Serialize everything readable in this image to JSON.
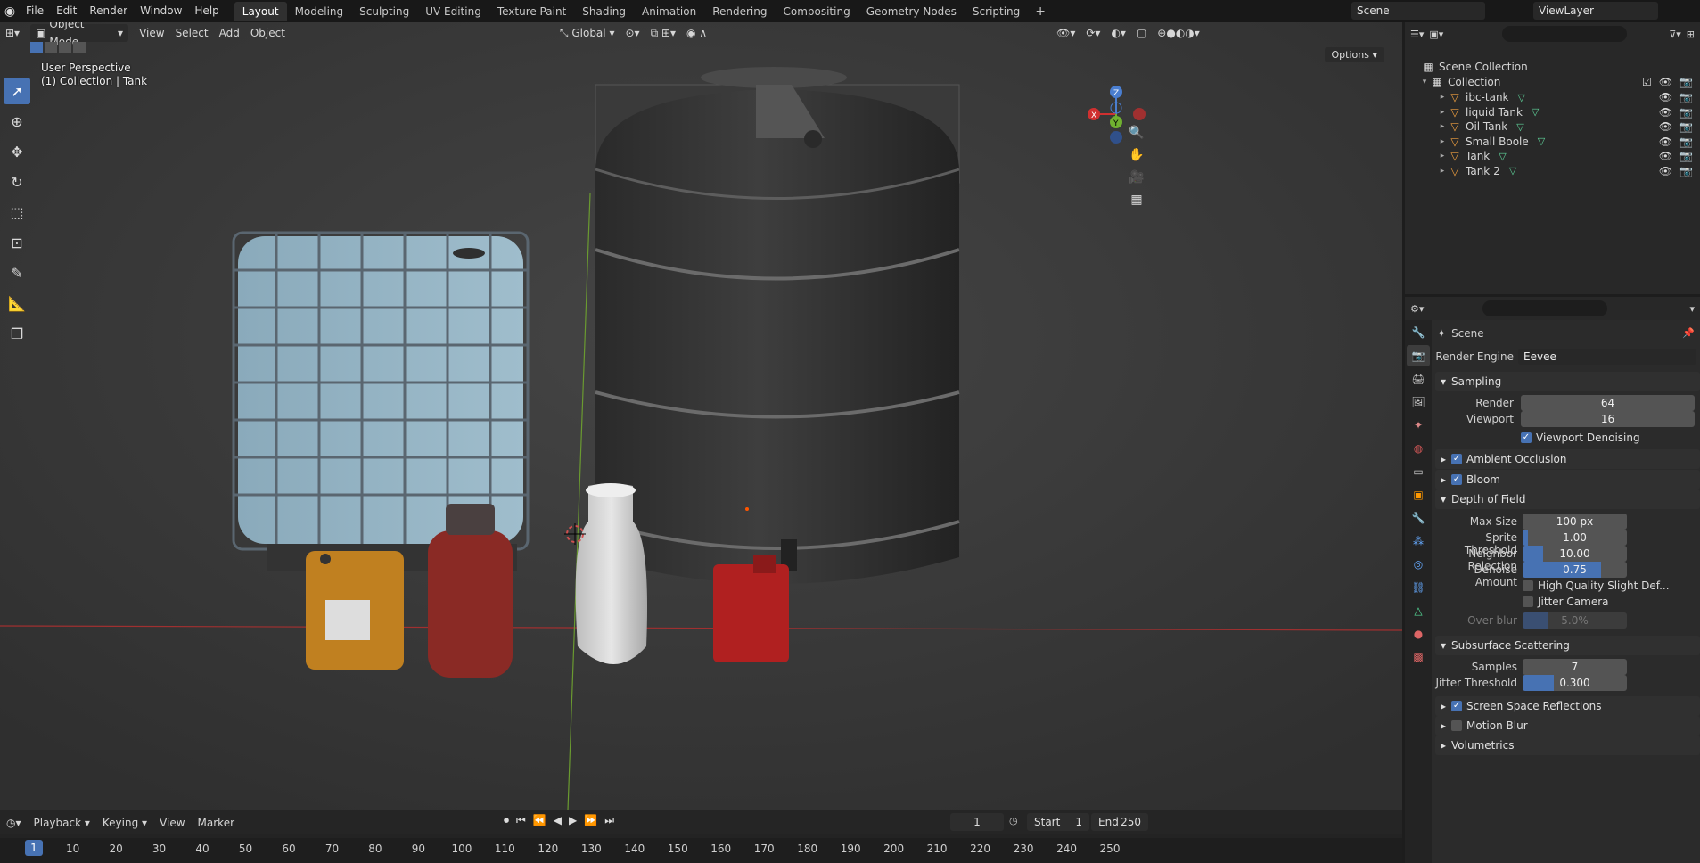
{
  "menu": {
    "items": [
      "File",
      "Edit",
      "Render",
      "Window",
      "Help"
    ],
    "workspaces": [
      "Layout",
      "Modeling",
      "Sculpting",
      "UV Editing",
      "Texture Paint",
      "Shading",
      "Animation",
      "Rendering",
      "Compositing",
      "Geometry Nodes",
      "Scripting"
    ],
    "active_workspace": "Layout",
    "scene_name": "Scene",
    "view_layer": "ViewLayer"
  },
  "viewport": {
    "mode": "Object Mode",
    "menus": [
      "View",
      "Select",
      "Add",
      "Object"
    ],
    "transform_orientation": "Global",
    "options_label": "Options",
    "perspective_label": "User Perspective",
    "collection_label": "(1) Collection | Tank",
    "gizmo_axes": [
      "X",
      "Y",
      "Z"
    ]
  },
  "timeline": {
    "menus": [
      "Playback",
      "Keying",
      "View",
      "Marker"
    ],
    "current_frame": "1",
    "start_label": "Start",
    "start_value": "1",
    "end_label": "End",
    "end_value": "250",
    "ticks": [
      "1",
      "10",
      "20",
      "30",
      "40",
      "50",
      "60",
      "70",
      "80",
      "90",
      "100",
      "110",
      "120",
      "130",
      "140",
      "150",
      "160",
      "170",
      "180",
      "190",
      "200",
      "210",
      "220",
      "230",
      "240",
      "250"
    ]
  },
  "outliner": {
    "root": "Scene Collection",
    "collection": "Collection",
    "objects": [
      "ibc-tank",
      "liquid Tank",
      "Oil Tank",
      "Small Boole",
      "Tank",
      "Tank 2"
    ]
  },
  "properties": {
    "context": "Scene",
    "render_engine_label": "Render Engine",
    "render_engine": "Eevee",
    "sampling": {
      "title": "Sampling",
      "render_label": "Render",
      "render": "64",
      "viewport_label": "Viewport",
      "viewport": "16",
      "denoise_label": "Viewport Denoising"
    },
    "ambient_occlusion": "Ambient Occlusion",
    "bloom": "Bloom",
    "dof": {
      "title": "Depth of Field",
      "max_size_label": "Max Size",
      "max_size": "100 px",
      "sprite_label": "Sprite Threshold",
      "sprite": "1.00",
      "sprite_fill": 0.05,
      "neighbor_label": "Neighbor Rejection",
      "neighbor": "10.00",
      "neighbor_fill": 0.2,
      "denoise_label": "Denoise Amount",
      "denoise": "0.75",
      "denoise_fill": 0.75,
      "hq_label": "High Quality Slight Def...",
      "jitter_label": "Jitter Camera",
      "overblur_label": "Over-blur",
      "overblur": "5.0%",
      "overblur_fill": 0.25
    },
    "sss": {
      "title": "Subsurface Scattering",
      "samples_label": "Samples",
      "samples": "7",
      "jitter_label": "Jitter Threshold",
      "jitter": "0.300",
      "jitter_fill": 0.3
    },
    "ssr": "Screen Space Reflections",
    "motion_blur": "Motion Blur",
    "volumetrics": "Volumetrics"
  }
}
